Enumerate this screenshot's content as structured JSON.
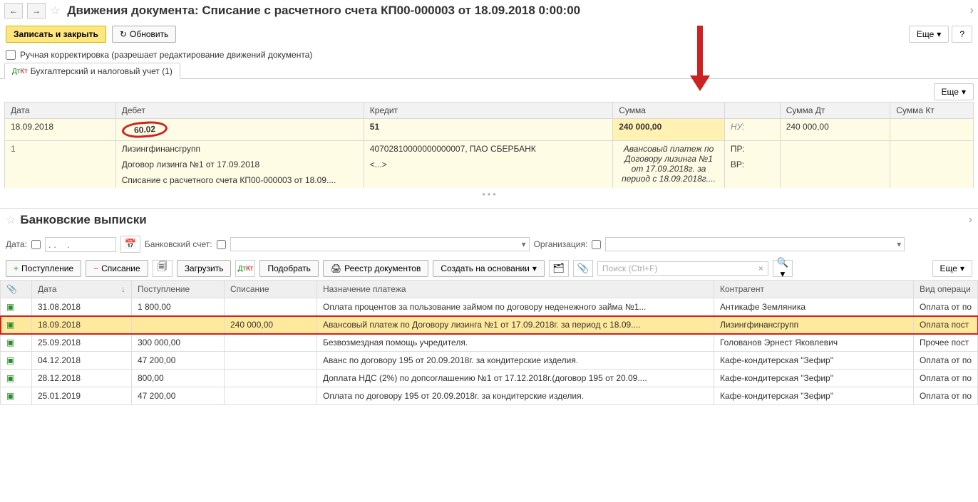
{
  "header": {
    "title": "Движения документа: Списание с расчетного счета КП00-000003 от 18.09.2018 0:00:00"
  },
  "toolbar1": {
    "save_close": "Записать и закрыть",
    "refresh": "Обновить",
    "more": "Еще",
    "help": "?"
  },
  "check": {
    "label": "Ручная корректировка (разрешает редактирование движений документа)"
  },
  "tabs": {
    "accounting": "Бухгалтерский и налоговый учет (1)"
  },
  "entry_more": "Еще",
  "entry_headers": {
    "date": "Дата",
    "debit": "Дебет",
    "credit": "Кредит",
    "sum": "Сумма",
    "sumdt": "Сумма Дт",
    "sumkt": "Сумма Кт"
  },
  "entry": {
    "date": "18.09.2018",
    "row_num": "1",
    "debit_account": "60.02",
    "credit_account": "51",
    "sum": "240 000,00",
    "nu_label": "НУ:",
    "pr_label": "ПР:",
    "vr_label": "ВР:",
    "sum_dt": "240 000,00",
    "debit_sub1": "Лизингфинансгрупп",
    "credit_sub1": "40702810000000000007, ПАО СБЕРБАНК",
    "sum_desc": "Авансовый платеж по Договору лизинга №1 от 17.09.2018г. за период с 18.09.2018г....",
    "debit_sub2": "Договор лизинга №1 от 17.09.2018",
    "credit_sub2": "<...>",
    "debit_sub3": "Списание с расчетного счета КП00-000003 от 18.09...."
  },
  "section2": {
    "title": "Банковские выписки"
  },
  "filters": {
    "date_label": "Дата:",
    "date_placeholder": ". .    .",
    "bank_label": "Банковский счет:",
    "org_label": "Организация:"
  },
  "toolbar2": {
    "income": "Поступление",
    "outcome": "Списание",
    "load": "Загрузить",
    "pick": "Подобрать",
    "registry": "Реестр документов",
    "create_basis": "Создать на основании",
    "search_placeholder": "Поиск (Ctrl+F)",
    "more": "Еще"
  },
  "bank_headers": {
    "date": "Дата",
    "income": "Поступление",
    "outcome": "Списание",
    "purpose": "Назначение платежа",
    "counterparty": "Контрагент",
    "oper": "Вид операци"
  },
  "bank_rows": [
    {
      "date": "31.08.2018",
      "income": "1 800,00",
      "outcome": "",
      "purpose": "Оплата процентов за пользование займом по договору неденежного займа №1...",
      "counterparty": "Антикафе Земляника",
      "oper": "Оплата от по"
    },
    {
      "date": "18.09.2018",
      "income": "",
      "outcome": "240 000,00",
      "purpose": "Авансовый платеж по  Договору лизинга №1 от 17.09.2018г. за период с 18.09....",
      "counterparty": "Лизингфинансгрупп",
      "oper": "Оплата пост",
      "hl": true
    },
    {
      "date": "25.09.2018",
      "income": "300 000,00",
      "outcome": "",
      "purpose": "Безвозмездная помощь учредителя.",
      "counterparty": "Голованов Эрнест Яковлевич",
      "oper": "Прочее пост"
    },
    {
      "date": "04.12.2018",
      "income": "47 200,00",
      "outcome": "",
      "purpose": "Аванс по договору 195 от 20.09.2018г. за кондитерские изделия.",
      "counterparty": "Кафе-кондитерская \"Зефир\"",
      "oper": "Оплата от по"
    },
    {
      "date": "28.12.2018",
      "income": "800,00",
      "outcome": "",
      "purpose": "Доплата НДС (2%) по допсоглашению №1 от 17.12.2018г.(договор 195 от 20.09....",
      "counterparty": "Кафе-кондитерская \"Зефир\"",
      "oper": "Оплата от по"
    },
    {
      "date": "25.01.2019",
      "income": "47 200,00",
      "outcome": "",
      "purpose": "Оплата по договору 195 от 20.09.2018г. за кондитерские изделия.",
      "counterparty": "Кафе-кондитерская \"Зефир\"",
      "oper": "Оплата от по"
    }
  ]
}
